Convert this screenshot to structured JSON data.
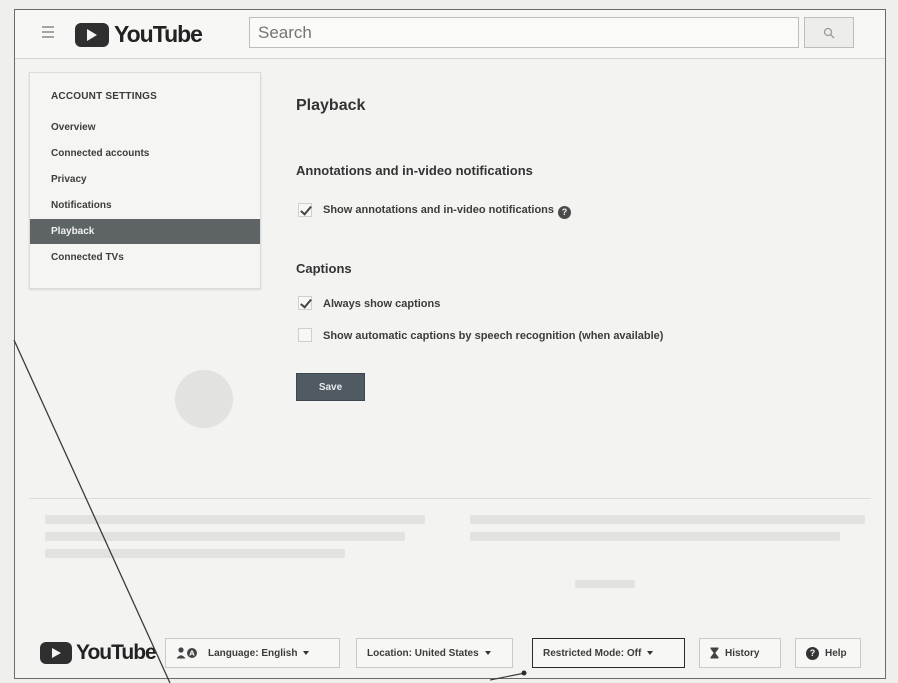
{
  "header": {
    "logo_text": "YouTube",
    "search": {
      "placeholder": "Search"
    }
  },
  "sidebar": {
    "heading": "ACCOUNT SETTINGS",
    "items": [
      {
        "label": "Overview",
        "active": false
      },
      {
        "label": "Connected accounts",
        "active": false
      },
      {
        "label": "Privacy",
        "active": false
      },
      {
        "label": "Notifications",
        "active": false
      },
      {
        "label": "Playback",
        "active": true
      },
      {
        "label": "Connected TVs",
        "active": false
      }
    ]
  },
  "main": {
    "title": "Playback",
    "annotations_section": {
      "title": "Annotations and in-video notifications",
      "option_label": "Show annotations and in-video notifications",
      "checked": true
    },
    "captions_section": {
      "title": "Captions",
      "options": [
        {
          "label": "Always show captions",
          "checked": true
        },
        {
          "label": "Show automatic captions by speech recognition (when available)",
          "checked": false
        }
      ]
    },
    "save_label": "Save"
  },
  "footer": {
    "logo_text": "YouTube",
    "language_label": "Language: English",
    "location_label": "Location: United States",
    "restricted_label": "Restricted Mode: Off",
    "history_label": "History",
    "help_label": "Help"
  },
  "colors": {
    "active_item_bg": "#5e6366",
    "save_button_bg": "#4f5a63",
    "page_bg": "#f3f3f1"
  }
}
